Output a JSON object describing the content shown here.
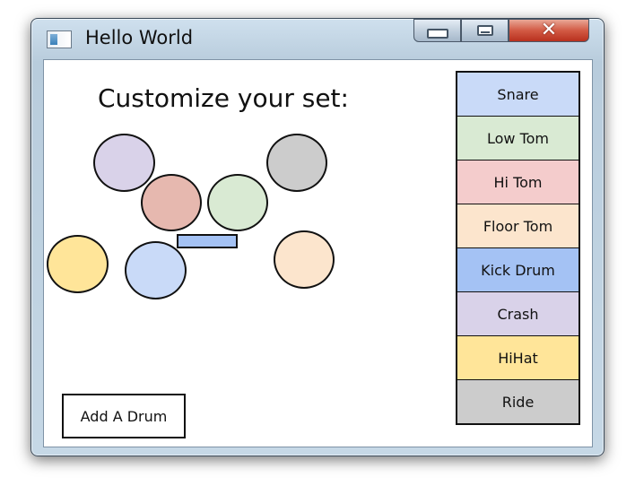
{
  "window": {
    "title": "Hello World"
  },
  "main": {
    "heading": "Customize your set:",
    "add_button_label": "Add A Drum"
  },
  "drum_list": {
    "items": [
      {
        "label": "Snare",
        "color": "#c9daf8"
      },
      {
        "label": "Low Tom",
        "color": "#d9ead3"
      },
      {
        "label": "Hi Tom",
        "color": "#f4cccc"
      },
      {
        "label": "Floor Tom",
        "color": "#fce5cd"
      },
      {
        "label": "Kick Drum",
        "color": "#a4c2f4"
      },
      {
        "label": "Crash",
        "color": "#d9d2e9"
      },
      {
        "label": "HiHat",
        "color": "#ffe599"
      },
      {
        "label": "Ride",
        "color": "#cccccc"
      }
    ]
  },
  "drum_kit": {
    "pieces": [
      {
        "kind": "circle",
        "color": "#d9d2e9"
      },
      {
        "kind": "circle",
        "color": "#e6b8af"
      },
      {
        "kind": "circle",
        "color": "#d9ead3"
      },
      {
        "kind": "circle",
        "color": "#cccccc"
      },
      {
        "kind": "circle",
        "color": "#ffe599"
      },
      {
        "kind": "circle",
        "color": "#c9daf8"
      },
      {
        "kind": "circle",
        "color": "#fce5cd"
      },
      {
        "kind": "rect",
        "color": "#a4c2f4"
      }
    ]
  }
}
